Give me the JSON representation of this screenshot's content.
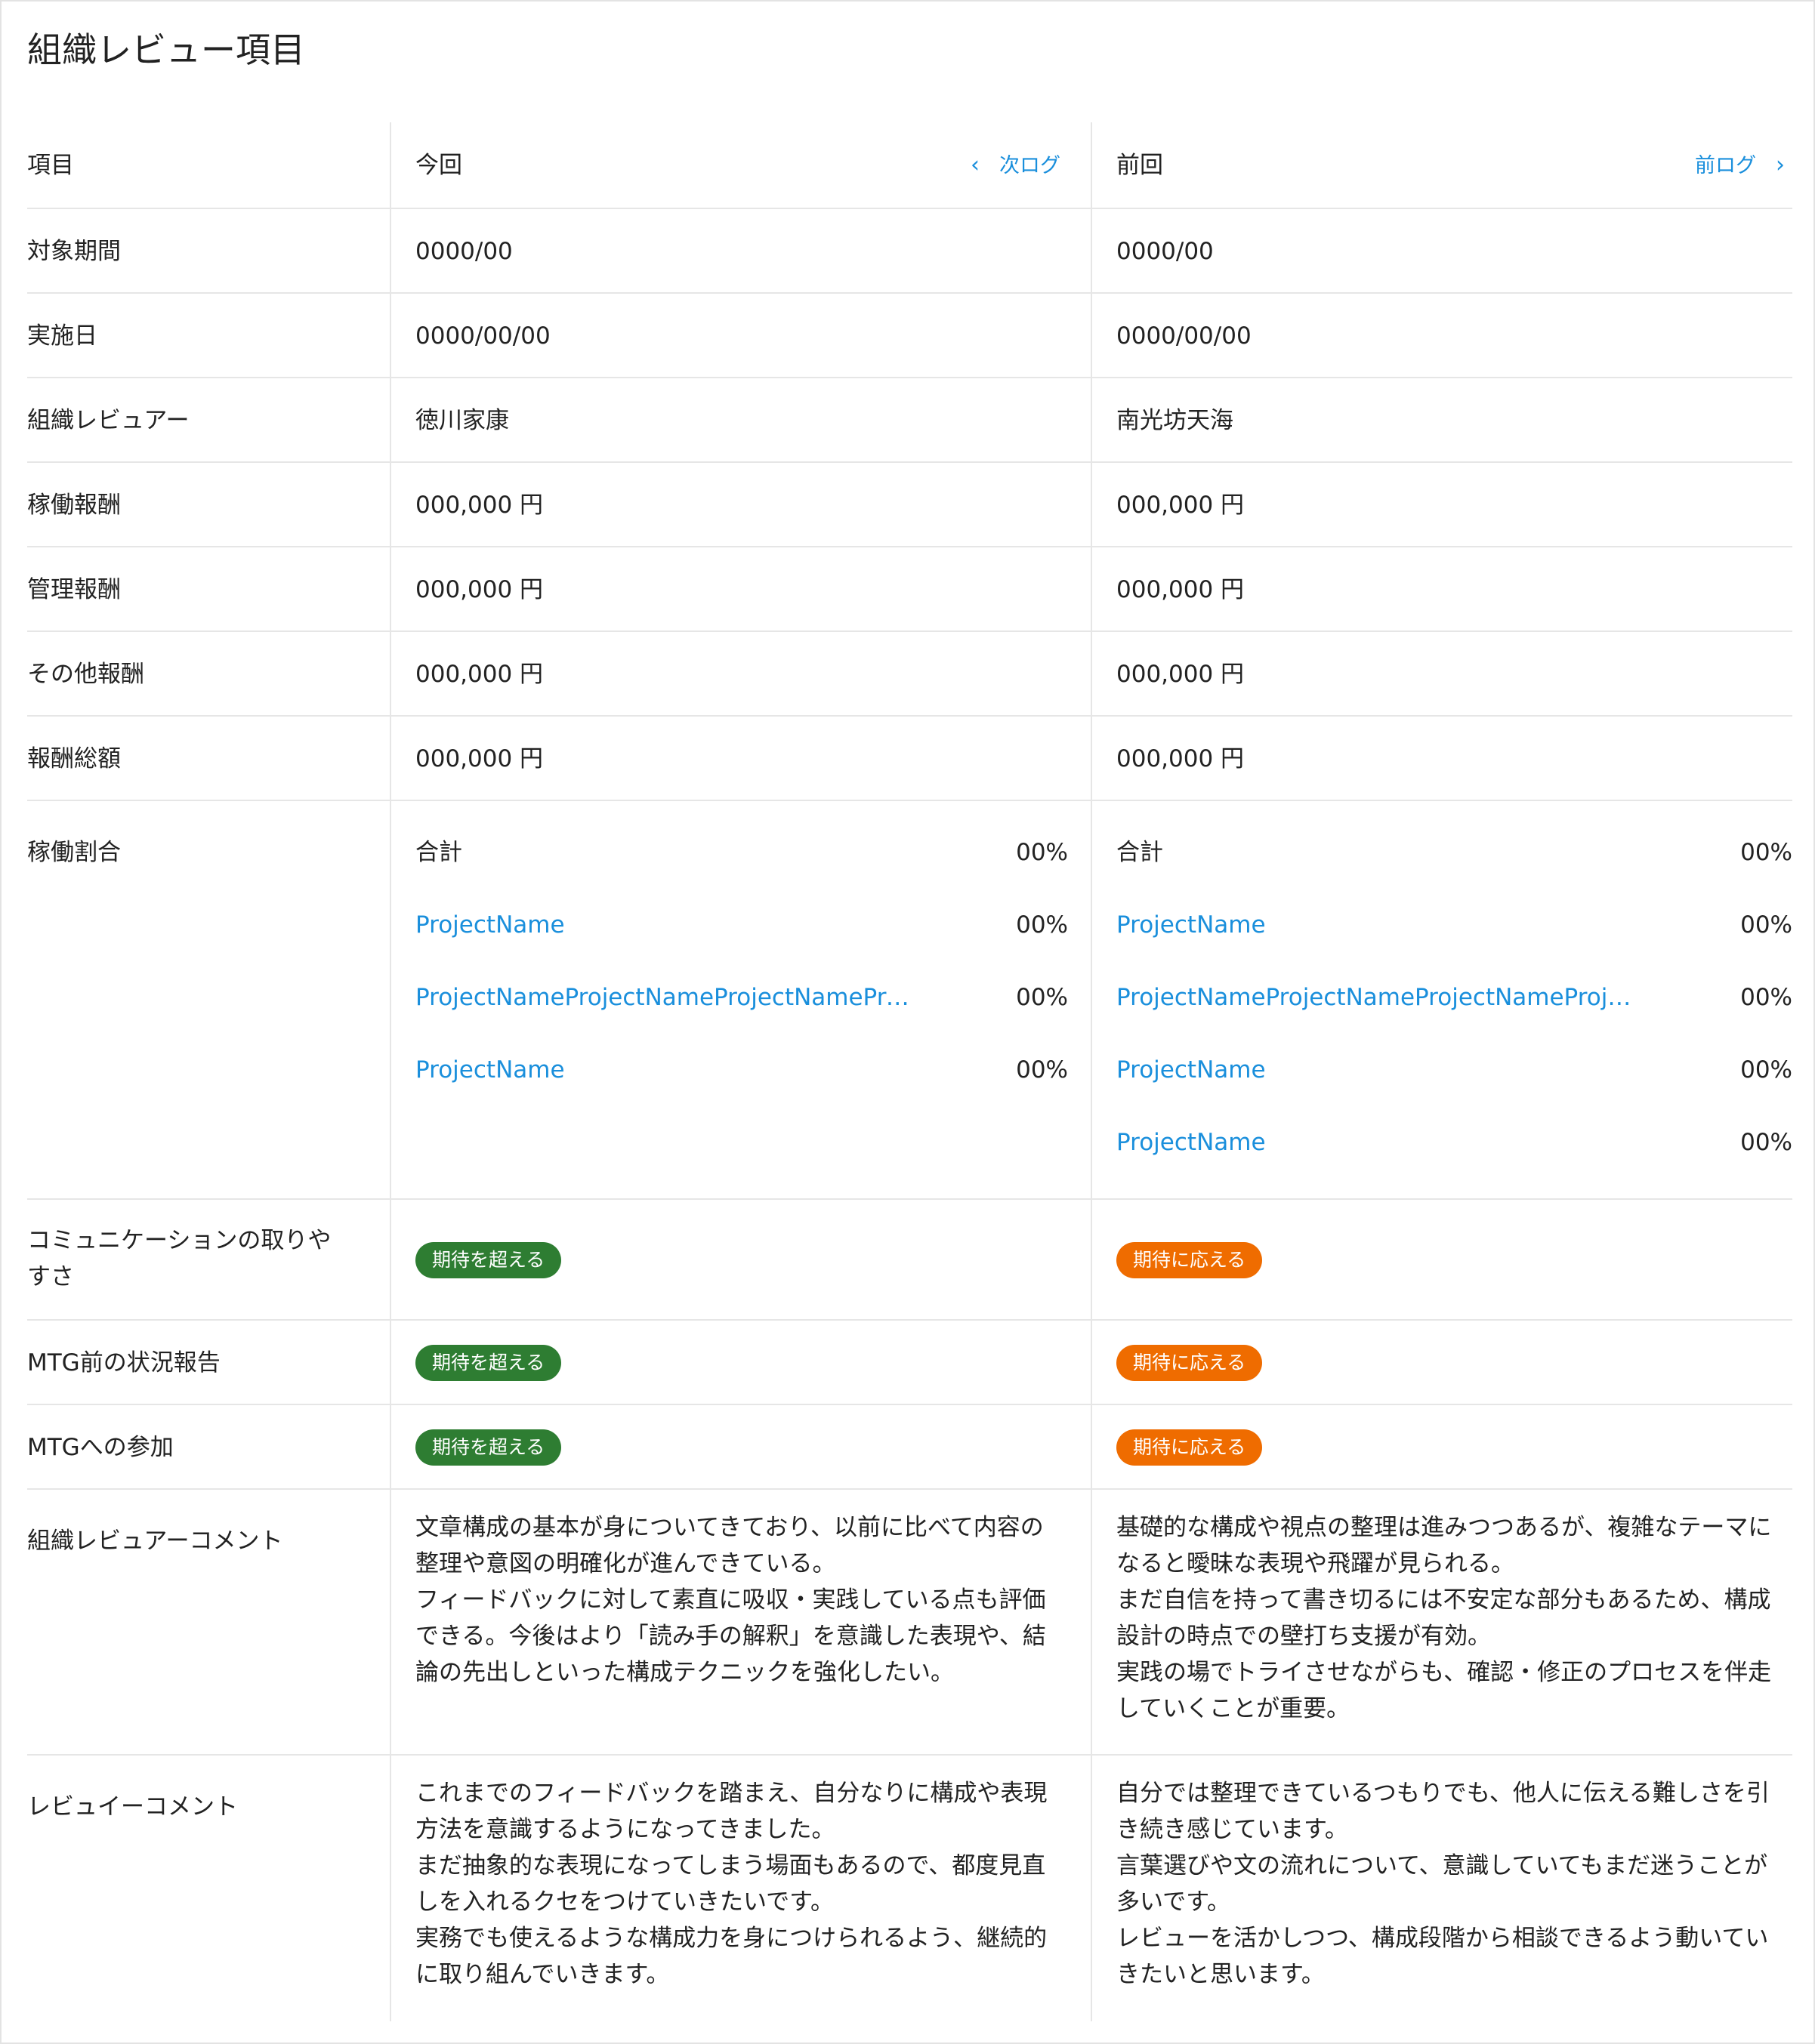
{
  "page": {
    "title": "組織レビュー項目"
  },
  "header": {
    "item_label": "項目",
    "current_label": "今回",
    "next_log": "次ログ",
    "previous_label": "前回",
    "prev_log": "前ログ"
  },
  "rows": {
    "period": {
      "label": "対象期間",
      "current": "0000/00",
      "previous": "0000/00"
    },
    "date": {
      "label": "実施日",
      "current": "0000/00/00",
      "previous": "0000/00/00"
    },
    "reviewer": {
      "label": "組織レビュアー",
      "current": "徳川家康",
      "previous": "南光坊天海"
    },
    "work_pay": {
      "label": "稼働報酬",
      "current": "000,000 円",
      "previous": "000,000 円"
    },
    "manage_pay": {
      "label": "管理報酬",
      "current": "000,000 円",
      "previous": "000,000 円"
    },
    "other_pay": {
      "label": "その他報酬",
      "current": "000,000 円",
      "previous": "000,000 円"
    },
    "total_pay": {
      "label": "報酬総額",
      "current": "000,000 円",
      "previous": "000,000 円"
    }
  },
  "ratio": {
    "label": "稼働割合",
    "current": [
      {
        "name": "合計",
        "value": "00%"
      },
      {
        "name": "ProjectName",
        "value": "00%"
      },
      {
        "name": "ProjectNameProjectNameProjectNameProjectName",
        "value": "00%"
      },
      {
        "name": "ProjectName",
        "value": "00%"
      }
    ],
    "previous": [
      {
        "name": "合計",
        "value": "00%"
      },
      {
        "name": "ProjectName",
        "value": "00%"
      },
      {
        "name": "ProjectNameProjectNameProjectNameProjectName",
        "value": "00%"
      },
      {
        "name": "ProjectName",
        "value": "00%"
      },
      {
        "name": "ProjectName",
        "value": "00%"
      }
    ]
  },
  "evaluations": {
    "communication": {
      "label": "コミュニケーションの取りやすさ",
      "current": "期待を超える",
      "previous": "期待に応える"
    },
    "pre_mtg": {
      "label": "MTG前の状況報告",
      "current": "期待を超える",
      "previous": "期待に応える"
    },
    "mtg": {
      "label": "MTGへの参加",
      "current": "期待を超える",
      "previous": "期待に応える"
    }
  },
  "comments": {
    "reviewer": {
      "label": "組織レビュアーコメント",
      "current": "文章構成の基本が身についてきており、以前に比べて内容の整理や意図の明確化が進んできている。\n フィードバックに対して素直に吸収・実践している点も評価できる。今後はより「読み手の解釈」を意識した表現や、結論の先出しといった構成テクニックを強化したい。",
      "previous": "基礎的な構成や視点の整理は進みつつあるが、複雑なテーマになると曖昧な表現や飛躍が見られる。\n まだ自信を持って書き切るには不安定な部分もあるため、構成設計の時点での壁打ち支援が有効。\n 実践の場でトライさせながらも、確認・修正のプロセスを伴走していくことが重要。"
    },
    "reviewee": {
      "label": "レビュイーコメント",
      "current": "これまでのフィードバックを踏まえ、自分なりに構成や表現方法を意識するようになってきました。\n まだ抽象的な表現になってしまう場面もあるので、都度見直しを入れるクセをつけていきたいです。\n 実務でも使えるような構成力を身につけられるよう、継続的に取り組んでいきます。",
      "previous": "自分では整理できているつもりでも、他人に伝える難しさを引き続き感じています。\n 言葉選びや文の流れについて、意識していてもまだ迷うことが多いです。\n レビューを活かしつつ、構成段階から相談できるよう動いていきたいと思います。"
    }
  },
  "colors": {
    "link": "#1a8fdc",
    "exceeds": "#2e7d32",
    "meets": "#ef6c00",
    "divider": "#e6e6e6"
  }
}
